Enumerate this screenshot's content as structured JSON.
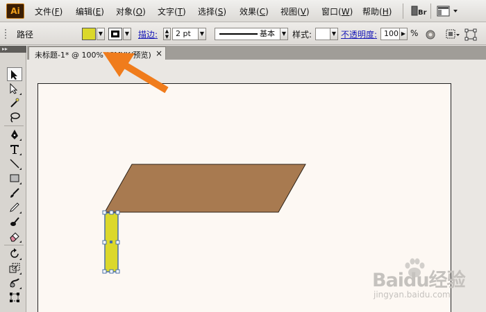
{
  "app": {
    "logo": "Ai",
    "icons": {
      "logo": "illustrator-logo-icon",
      "bridge": "bridge-button-icon",
      "workspace": "workspace-switcher-icon"
    }
  },
  "menu": [
    {
      "label": "文件",
      "key": "F"
    },
    {
      "label": "编辑",
      "key": "E"
    },
    {
      "label": "对象",
      "key": "O"
    },
    {
      "label": "文字",
      "key": "T"
    },
    {
      "label": "选择",
      "key": "S"
    },
    {
      "label": "效果",
      "key": "C"
    },
    {
      "label": "视图",
      "key": "V"
    },
    {
      "label": "窗口",
      "key": "W"
    },
    {
      "label": "帮助",
      "key": "H"
    }
  ],
  "bridge_label": "Br",
  "control": {
    "selection_label": "路径",
    "fill_color": "#dbd82b",
    "stroke_color": "#000000",
    "stroke_label": "描边:",
    "stroke_weight": "2 pt",
    "stroke_profile": "基本",
    "style_label": "样式:",
    "opacity_label": "不透明度:",
    "opacity_value": "100",
    "opacity_unit": "%"
  },
  "tools": [
    "selection-tool-icon",
    "direct-selection-tool-icon",
    "magic-wand-tool-icon",
    "lasso-tool-icon",
    "pen-tool-icon",
    "type-tool-icon",
    "line-tool-icon",
    "rectangle-tool-icon",
    "paintbrush-tool-icon",
    "pencil-tool-icon",
    "blob-brush-tool-icon",
    "eraser-tool-icon",
    "rotate-tool-icon",
    "scale-tool-icon",
    "warp-tool-icon",
    "free-transform-tool-icon"
  ],
  "document": {
    "tab_label": "未标题-1* @ 100% (CMYK/预览)",
    "close_symbol": "×"
  },
  "artwork": {
    "tabletop_color": "#a87a50",
    "leg_color": "#dbd82b",
    "selection_color": "#4a6fa5",
    "annotation_arrow_color": "#f07c1c"
  },
  "watermark": {
    "brand": "Baidu经验",
    "url": "jingyan.baidu.com"
  }
}
